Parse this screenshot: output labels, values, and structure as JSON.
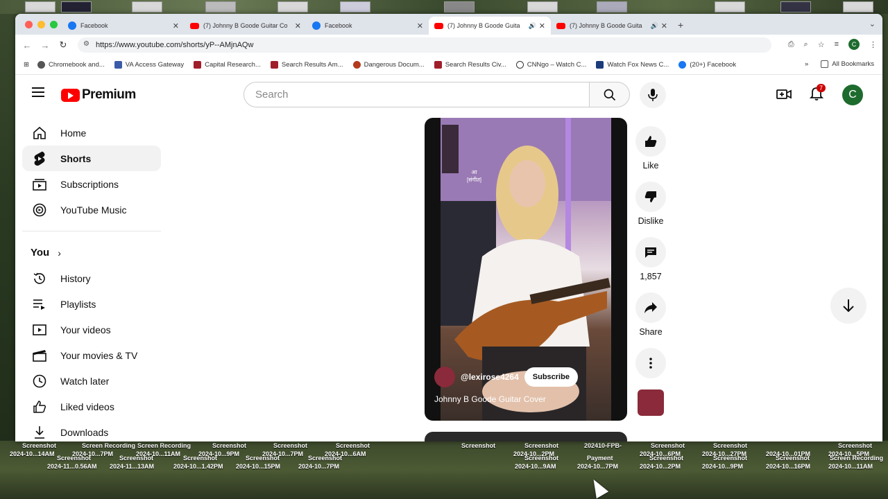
{
  "browser": {
    "tabs": [
      {
        "title": "Facebook",
        "icon": "facebook-icon",
        "active": false
      },
      {
        "title": "(7) Johnny B Goode Guitar Co",
        "icon": "youtube-icon",
        "active": false
      },
      {
        "title": "Facebook",
        "icon": "facebook-icon",
        "active": false
      },
      {
        "title": "(7) Johnny B Goode Guita",
        "icon": "youtube-icon",
        "active": true
      },
      {
        "title": "(7) Johnny B Goode Guita",
        "icon": "youtube-icon",
        "active": false
      }
    ],
    "url": "https://www.youtube.com/shorts/yP--AMjnAQw",
    "profile_initial": "C",
    "bookmarks": [
      {
        "label": "Chromebook and...",
        "color": "#555555"
      },
      {
        "label": "VA Access Gateway",
        "color": "#3b5ba8"
      },
      {
        "label": "Capital Research...",
        "color": "#a01e2a"
      },
      {
        "label": "Search Results Am...",
        "color": "#a01e2a"
      },
      {
        "label": "Dangerous Docum...",
        "color": "#b43a1e"
      },
      {
        "label": "Search Results Civ...",
        "color": "#a01e2a"
      },
      {
        "label": "CNNgo – Watch C...",
        "color": "#333333"
      },
      {
        "label": "Watch Fox News C...",
        "color": "#1c3b7a"
      },
      {
        "label": "(20+) Facebook",
        "color": "#1877f2"
      }
    ],
    "all_bookmarks": "All Bookmarks"
  },
  "youtube": {
    "logo_text": "Premium",
    "search_placeholder": "Search",
    "notification_count": "7",
    "avatar_initial": "C",
    "sidebar": {
      "main": [
        {
          "label": "Home",
          "icon": "home-icon",
          "active": false
        },
        {
          "label": "Shorts",
          "icon": "shorts-icon",
          "active": true
        },
        {
          "label": "Subscriptions",
          "icon": "subscriptions-icon",
          "active": false
        },
        {
          "label": "YouTube Music",
          "icon": "music-icon",
          "active": false
        }
      ],
      "you_header": "You",
      "you": [
        {
          "label": "History",
          "icon": "history-icon"
        },
        {
          "label": "Playlists",
          "icon": "playlists-icon"
        },
        {
          "label": "Your videos",
          "icon": "your-videos-icon"
        },
        {
          "label": "Your movies & TV",
          "icon": "movies-icon"
        },
        {
          "label": "Watch later",
          "icon": "clock-icon"
        },
        {
          "label": "Liked videos",
          "icon": "thumbs-up-icon"
        },
        {
          "label": "Downloads",
          "icon": "download-icon"
        }
      ]
    },
    "short": {
      "channel": "@lexirose4264",
      "subscribe_label": "Subscribe",
      "title": "Johnny B Goode Guitar Cover",
      "overlay_line1": "आ",
      "overlay_line2": "[संगीत]"
    },
    "actions": {
      "like": "Like",
      "dislike": "Dislike",
      "comments": "1,857",
      "share": "Share"
    }
  },
  "desktop": {
    "file_labels_row1": [
      "Screenshot",
      "Screen Recording",
      "Screen Recording",
      "Screenshot",
      "Screenshot",
      "Screenshot",
      "Screenshot",
      "Screenshot",
      "Screenshot",
      "202410-FPB-",
      "Screenshot",
      "Screenshot",
      "Screenshot"
    ],
    "file_dates_row1": [
      "2024-10...14AM",
      "2024-10...7PM",
      "2024-10...11AM",
      "2024-10...9PM",
      "2024-10...7PM",
      "2024-10...6AM",
      "2024-10...2PM",
      "2024-10...6PM",
      "2024-10...27PM",
      "2024-10...01PM",
      "2024-10...5PM"
    ],
    "file_labels_row2": [
      "Screenshot",
      "Screenshot",
      "Screenshot",
      "Screenshot",
      "Screenshot",
      "Screenshot",
      "Screenshot",
      "Payment",
      "Screenshot",
      "Screenshot",
      "Screenshot",
      "Screen Recording"
    ],
    "file_dates_row2": [
      "2024-11...0.56AM",
      "2024-11...13AM",
      "2024-10...1.42PM",
      "2024-10...15PM",
      "2024-10...7PM",
      "2024-10...9AM",
      "2024-10...7PM",
      "2024-10...2PM",
      "2024-10...9PM",
      "2024-10...16PM",
      "2024-10...11AM"
    ]
  }
}
